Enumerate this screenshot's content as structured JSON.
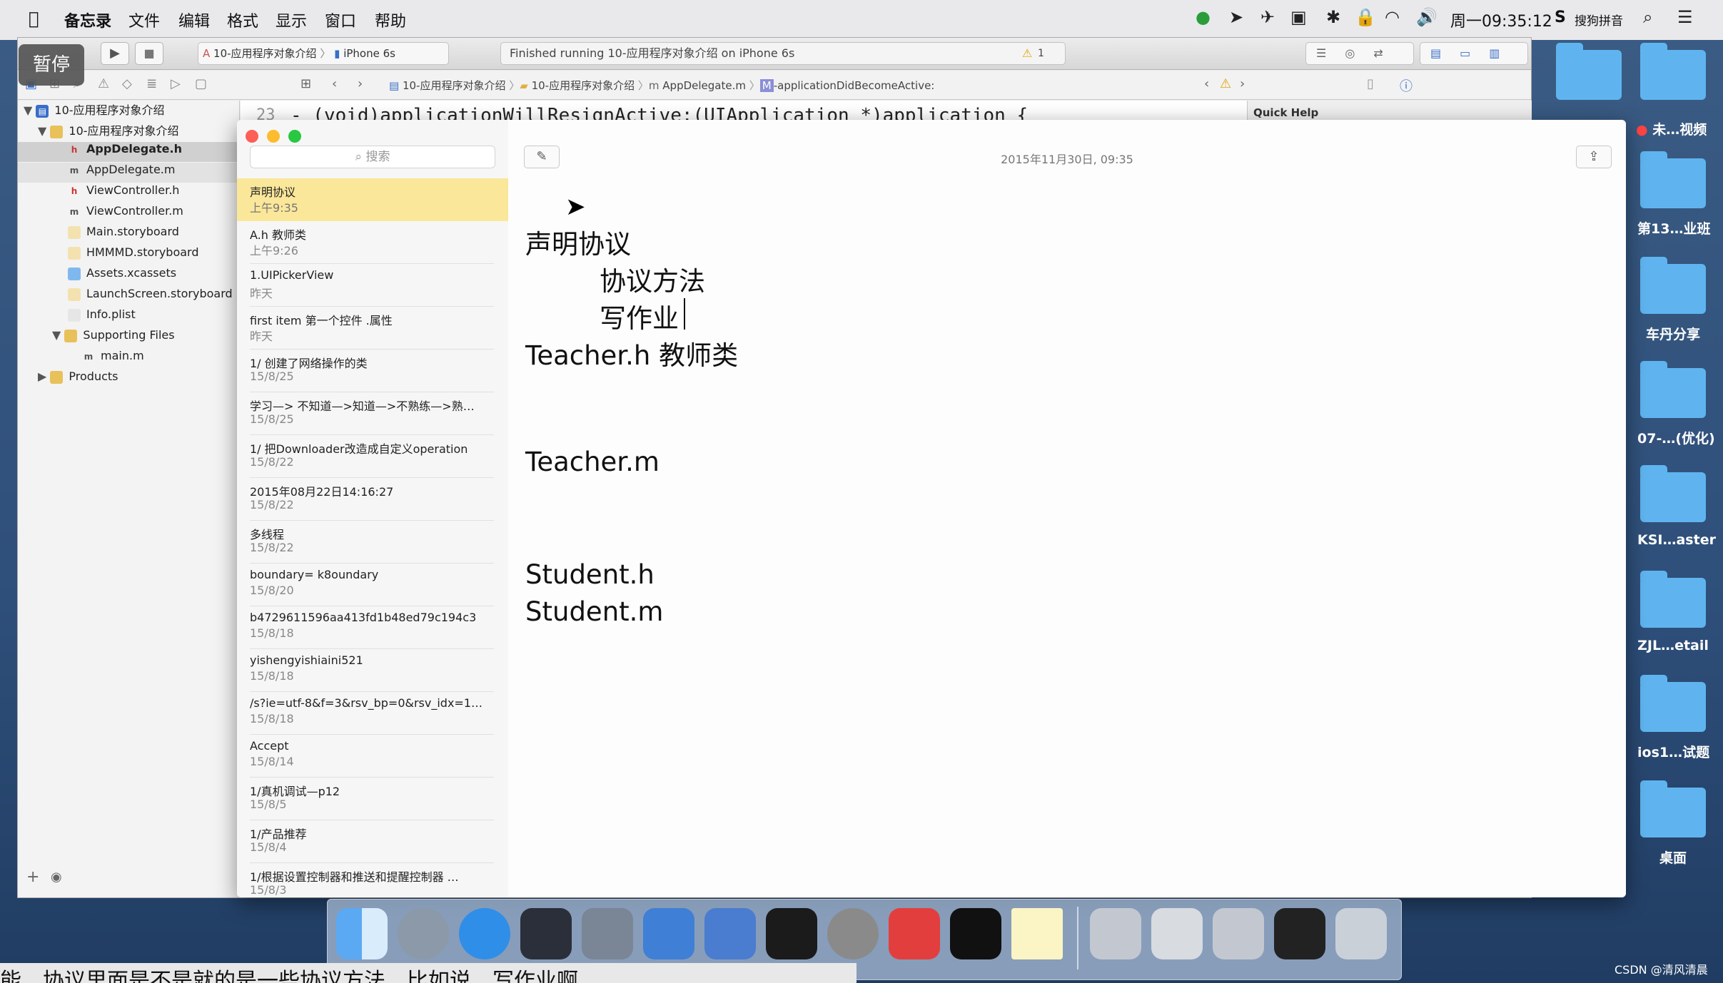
{
  "menubar": {
    "app": "备忘录",
    "items": [
      "文件",
      "编辑",
      "格式",
      "显示",
      "窗口",
      "帮助"
    ],
    "clock": "周一09:35:12",
    "ime": "搜狗拼音"
  },
  "overlay": {
    "pause_label": "暂停"
  },
  "xcode": {
    "scheme": "10-应用程序对象介绍",
    "device": "iPhone 6s",
    "status": "Finished running 10-应用程序对象介绍 on iPhone 6s",
    "warning_count": "1",
    "jump_bar": [
      "10-应用程序对象介绍",
      "10-应用程序对象介绍",
      "AppDelegate.m",
      "-applicationDidBecomeActive:"
    ],
    "line_number": "23",
    "code_line": "- (void)applicationWillResignActive:(UIApplication *)application {",
    "quick_help_title": "Quick Help",
    "tree": [
      {
        "label": "10-应用程序对象介绍",
        "badge": ""
      },
      {
        "label": "10-应用程序对象介绍",
        "badge": ""
      },
      {
        "label": "AppDelegate.h",
        "badge": "h"
      },
      {
        "label": "AppDelegate.m",
        "badge": "m"
      },
      {
        "label": "ViewController.h",
        "badge": "h"
      },
      {
        "label": "ViewController.m",
        "badge": "m"
      },
      {
        "label": "Main.storyboard",
        "badge": ""
      },
      {
        "label": "HMMMD.storyboard",
        "badge": ""
      },
      {
        "label": "Assets.xcassets",
        "badge": ""
      },
      {
        "label": "LaunchScreen.storyboard",
        "badge": ""
      },
      {
        "label": "Info.plist",
        "badge": ""
      },
      {
        "label": "Supporting Files",
        "badge": ""
      },
      {
        "label": "main.m",
        "badge": "m"
      },
      {
        "label": "Products",
        "badge": ""
      }
    ]
  },
  "notes": {
    "search_placeholder": "搜索",
    "date_header": "2015年11月30日, 09:35",
    "list": [
      {
        "title": "声明协议",
        "date": "上午9:35"
      },
      {
        "title": "A.h  教师类",
        "date": "上午9:26"
      },
      {
        "title": "1.UIPickerView",
        "date": "昨天"
      },
      {
        "title": "first item 第一个控件 .属性",
        "date": "昨天"
      },
      {
        "title": "1/ 创建了网络操作的类",
        "date": "15/8/25"
      },
      {
        "title": "学习—> 不知道—>知道—>不熟练—>熟…",
        "date": "15/8/25"
      },
      {
        "title": "1/ 把Downloader改造成自定义operation",
        "date": "15/8/22"
      },
      {
        "title": "2015年08月22日14:16:27",
        "date": "15/8/22"
      },
      {
        "title": "多线程",
        "date": "15/8/22"
      },
      {
        "title": "boundary= k8oundary",
        "date": "15/8/20"
      },
      {
        "title": "b4729611596aa413fd1b48ed79c194c3",
        "date": "15/8/18"
      },
      {
        "title": "yishengyishiaini521",
        "date": "15/8/18"
      },
      {
        "title": "/s?ie=utf-8&f=3&rsv_bp=0&rsv_idx=1…",
        "date": "15/8/18"
      },
      {
        "title": "Accept",
        "date": "15/8/14"
      },
      {
        "title": "1/真机调试—p12",
        "date": "15/8/5"
      },
      {
        "title": "1/产品推荐",
        "date": "15/8/4"
      },
      {
        "title": "1/根据设置控制器和推送和提醒控制器 …",
        "date": "15/8/3"
      }
    ],
    "body_lines": [
      "声明协议",
      "协议方法",
      "写作业",
      "Teacher.h 教师类",
      "Teacher.m",
      "Student.h",
      "Student.m"
    ]
  },
  "desktop": {
    "labels": [
      "未…视频",
      "第13…业班",
      "车丹分享",
      "07-…(优化)",
      "KSI…aster",
      "ZJL…etail",
      "ios1…试题",
      "桌面"
    ]
  },
  "caption": "能，协议里面是不是就的是一些协议方法，比如说，写作业啊",
  "watermark": "CSDN @清风清晨"
}
